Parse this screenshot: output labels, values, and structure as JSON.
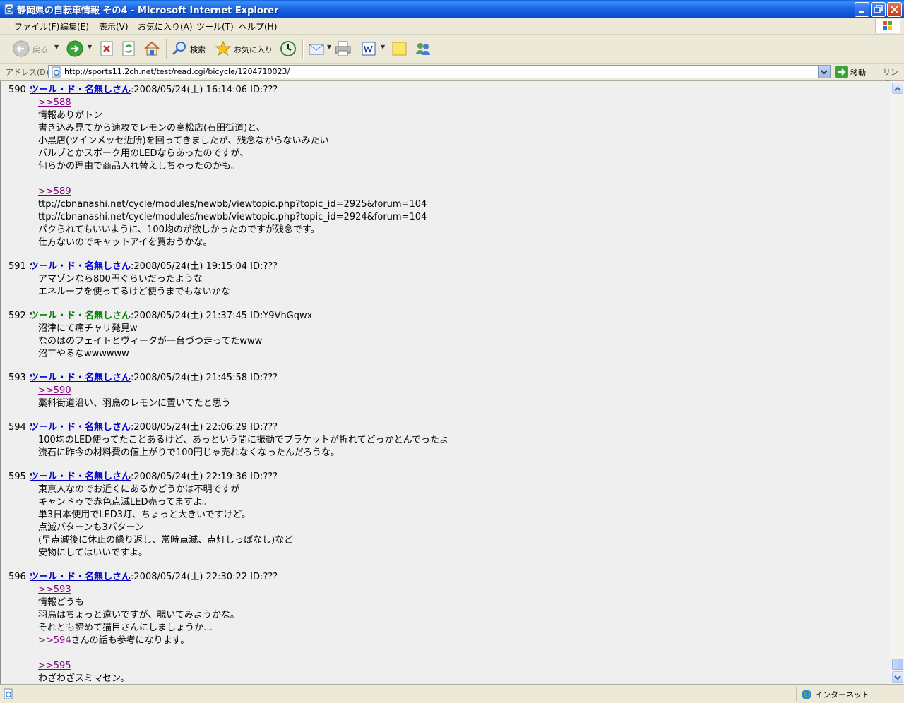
{
  "window": {
    "title": "静岡県の自転車情報 その4 - Microsoft Internet Explorer"
  },
  "menu": [
    {
      "label": "ファイル(F)"
    },
    {
      "label": "編集(E)"
    },
    {
      "label": "表示(V)"
    },
    {
      "label": "お気に入り(A)"
    },
    {
      "label": "ツール(T)"
    },
    {
      "label": "ヘルプ(H)"
    }
  ],
  "toolbar": {
    "back_label": "戻る",
    "search_label": "検索",
    "favorites_label": "お気に入り"
  },
  "address": {
    "label": "アドレス(D)",
    "url": "http://sports11.2ch.net/test/read.cgi/bicycle/1204710023/",
    "go_label": "移動",
    "links_label": "リンク"
  },
  "posts": [
    {
      "number": "590 :",
      "name": "ツール・ド・名無しさん",
      "meta": ":2008/05/24(土) 16:14:06 ID:???",
      "lines": [
        {
          "anchor": ">>588",
          "text": ""
        },
        {
          "text": "情報ありがトン"
        },
        {
          "text": "書き込み見てから速攻でレモンの高松店(石田街道)と、"
        },
        {
          "text": "小黒店(ツインメッセ近所)を回ってきましたが、残念ながらないみたい"
        },
        {
          "text": "バルブとかスポーク用のLEDならあったのですが、"
        },
        {
          "text": "何らかの理由で商品入れ替えしちゃったのかも。"
        },
        {
          "text": ""
        },
        {
          "anchor": ">>589",
          "text": ""
        },
        {
          "text": "ttp://cbnanashi.net/cycle/modules/newbb/viewtopic.php?topic_id=2925&forum=104"
        },
        {
          "text": "ttp://cbnanashi.net/cycle/modules/newbb/viewtopic.php?topic_id=2924&forum=104"
        },
        {
          "text": "パクられてもいいように、100均のが欲しかったのですが残念です。"
        },
        {
          "text": "仕方ないのでキャットアイを買おうかな。"
        }
      ]
    },
    {
      "number": "591 :",
      "name": "ツール・ド・名無しさん",
      "meta": ":2008/05/24(土) 19:15:04 ID:???",
      "lines": [
        {
          "text": "アマゾンなら800円ぐらいだったような"
        },
        {
          "text": "エネループを使ってるけど使うまでもないかな"
        }
      ]
    },
    {
      "number": "592 :",
      "name": "ツール・ド・名無しさん",
      "meta": ":2008/05/24(土) 21:37:45 ID:Y9VhGqwx",
      "plain": true,
      "lines": [
        {
          "text": "沼津にて痛チャリ発見w"
        },
        {
          "text": "なのはのフェイトとヴィータが一台づつ走ってたwww"
        },
        {
          "text": "沼工やるなwwwwww"
        }
      ]
    },
    {
      "number": "593 :",
      "name": "ツール・ド・名無しさん",
      "meta": ":2008/05/24(土) 21:45:58 ID:???",
      "lines": [
        {
          "anchor": ">>590",
          "text": ""
        },
        {
          "text": "藁科街道沿い、羽鳥のレモンに置いてたと思う"
        }
      ]
    },
    {
      "number": "594 :",
      "name": "ツール・ド・名無しさん",
      "meta": ":2008/05/24(土) 22:06:29 ID:???",
      "lines": [
        {
          "text": "100均のLED使ってたことあるけど、あっという間に振動でブラケットが折れてどっかとんでったよ"
        },
        {
          "text": "流石に昨今の材料費の値上がりで100円じゃ売れなくなったんだろうな。"
        }
      ]
    },
    {
      "number": "595 :",
      "name": "ツール・ド・名無しさん",
      "meta": ":2008/05/24(土) 22:19:36 ID:???",
      "lines": [
        {
          "text": "東京人なのでお近くにあるかどうかは不明ですが"
        },
        {
          "text": "キャンドゥで赤色点滅LED売ってますよ。"
        },
        {
          "text": "単3日本使用でLED3灯、ちょっと大きいですけど。"
        },
        {
          "text": "点滅パターンも3パターン"
        },
        {
          "text": "(早点滅後に休止の繰り返し、常時点滅、点灯しっぱなし)など"
        },
        {
          "text": "安物にしてはいいですよ。"
        }
      ]
    },
    {
      "number": "596 :",
      "name": "ツール・ド・名無しさん",
      "meta": ":2008/05/24(土) 22:30:22 ID:???",
      "lines": [
        {
          "anchor": ">>593",
          "text": ""
        },
        {
          "text": "情報どうも"
        },
        {
          "text": "羽鳥はちょっと遠いですが、覗いてみようかな。"
        },
        {
          "text": "それとも諦めて猫目さんにしましょうか…"
        },
        {
          "anchor": ">>594",
          "text": "さんの話も参考になります。"
        },
        {
          "text": ""
        },
        {
          "anchor": ">>595",
          "text": ""
        },
        {
          "text": "わざわざスミマセン。"
        }
      ]
    }
  ],
  "status": {
    "zone": "インターネット"
  }
}
